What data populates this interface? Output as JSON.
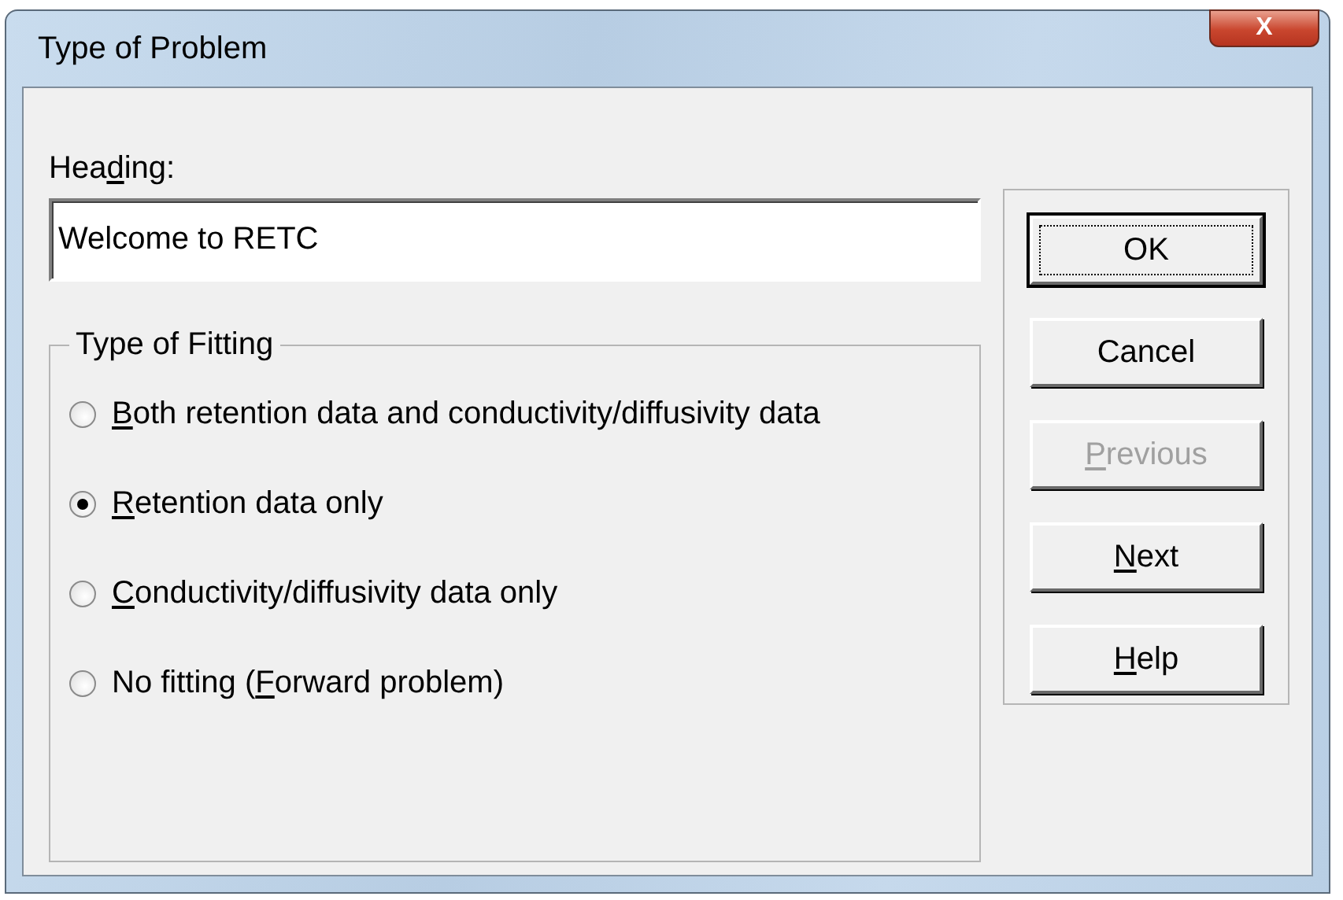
{
  "window": {
    "title": "Type of Problem",
    "close_label": "X"
  },
  "heading": {
    "label_parts": [
      {
        "text": "Hea",
        "underlined": false
      },
      {
        "text": "d",
        "underlined": true
      },
      {
        "text": "ing:",
        "underlined": false
      }
    ],
    "value": "Welcome to RETC"
  },
  "fitting": {
    "legend": "Type of Fitting",
    "options": [
      {
        "label_parts": [
          {
            "text": "B",
            "underlined": true
          },
          {
            "text": "oth retention data and conductivity/diffusivity data",
            "underlined": false
          }
        ],
        "selected": false
      },
      {
        "label_parts": [
          {
            "text": "R",
            "underlined": true
          },
          {
            "text": "etention data only",
            "underlined": false
          }
        ],
        "selected": true
      },
      {
        "label_parts": [
          {
            "text": "C",
            "underlined": true
          },
          {
            "text": "onductivity/diffusivity data only",
            "underlined": false
          }
        ],
        "selected": false
      },
      {
        "label_parts": [
          {
            "text": "No fitting (",
            "underlined": false
          },
          {
            "text": "F",
            "underlined": true
          },
          {
            "text": "orward problem)",
            "underlined": false
          }
        ],
        "selected": false
      }
    ]
  },
  "buttons": [
    {
      "label_parts": [
        {
          "text": "OK",
          "underlined": false
        }
      ],
      "default": true,
      "disabled": false
    },
    {
      "label_parts": [
        {
          "text": "Cancel",
          "underlined": false
        }
      ],
      "default": false,
      "disabled": false
    },
    {
      "label_parts": [
        {
          "text": "P",
          "underlined": true
        },
        {
          "text": "revious",
          "underlined": false
        }
      ],
      "default": false,
      "disabled": true
    },
    {
      "label_parts": [
        {
          "text": "N",
          "underlined": true
        },
        {
          "text": "ext",
          "underlined": false
        }
      ],
      "default": false,
      "disabled": false
    },
    {
      "label_parts": [
        {
          "text": "H",
          "underlined": true
        },
        {
          "text": "elp",
          "underlined": false
        }
      ],
      "default": false,
      "disabled": false
    }
  ]
}
